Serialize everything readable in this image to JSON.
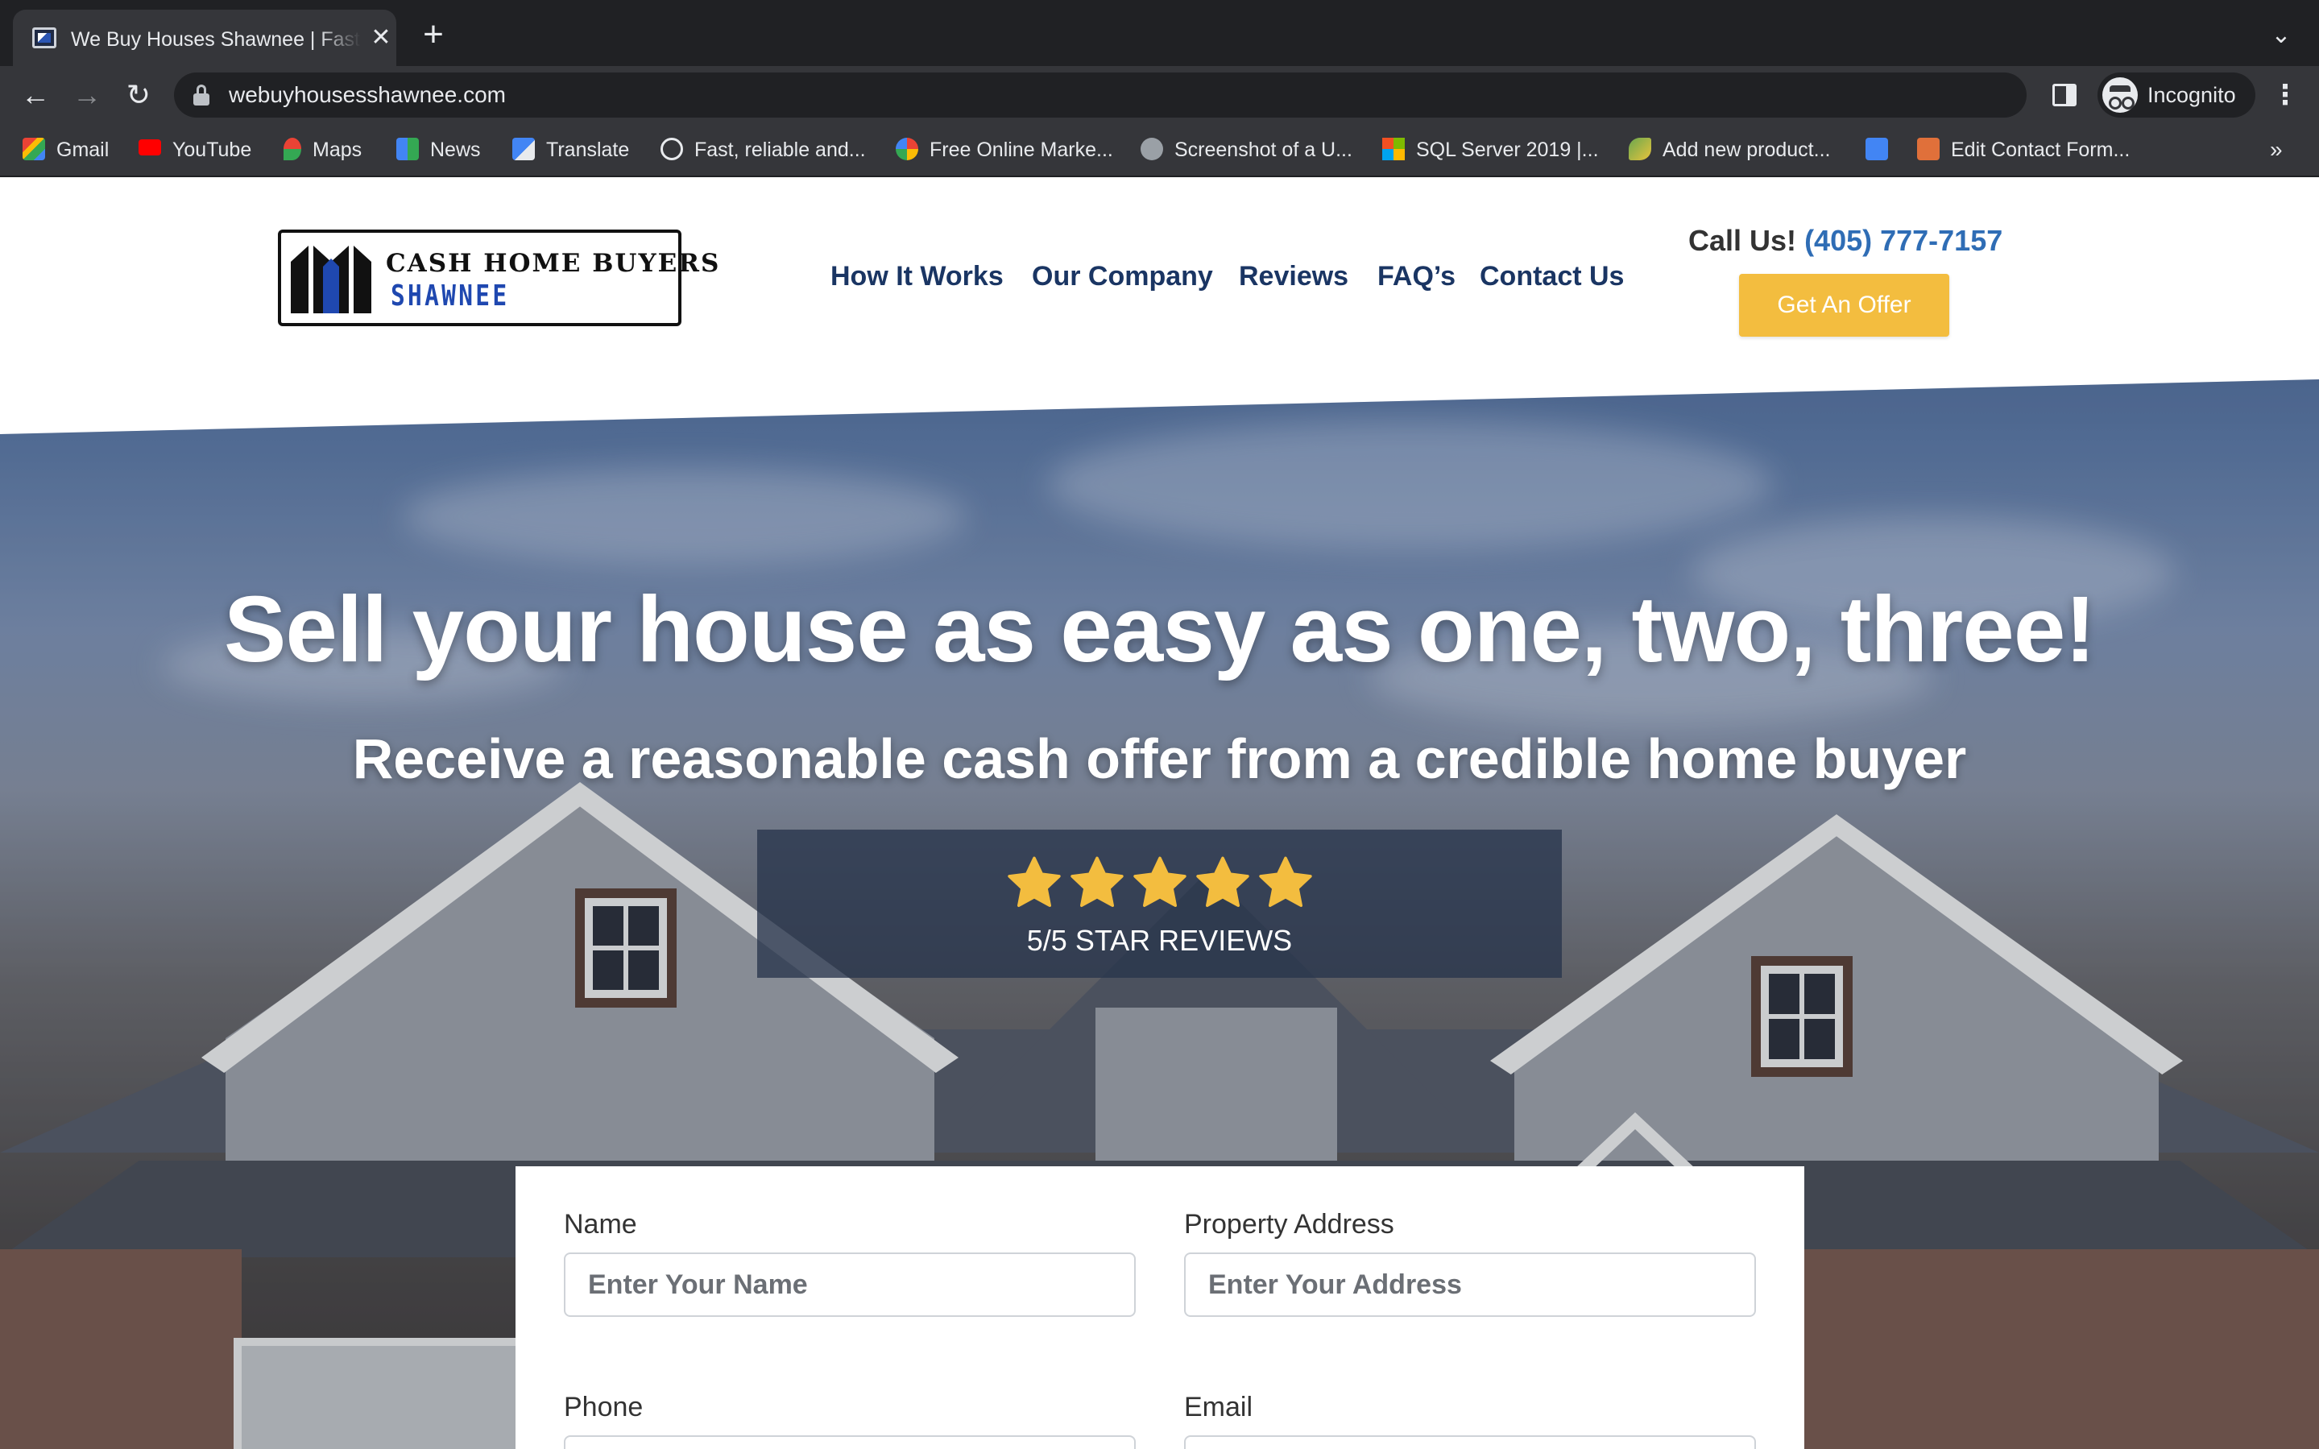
{
  "browser": {
    "tab_title": "We Buy Houses Shawnee | Fast Cash",
    "url": "webuyhousesshawnee.com",
    "profile_label": "Incognito",
    "bookmarks": [
      {
        "label": "Gmail",
        "icon": "gmail-icon",
        "color": "#ea4335"
      },
      {
        "label": "YouTube",
        "icon": "youtube-icon",
        "color": "#ff0000"
      },
      {
        "label": "Maps",
        "icon": "maps-icon",
        "color": "#34a853"
      },
      {
        "label": "News",
        "icon": "news-icon",
        "color": "#4285f4"
      },
      {
        "label": "Translate",
        "icon": "translate-icon",
        "color": "#4285f4"
      },
      {
        "label": "Fast, reliable and...",
        "icon": "site-icon",
        "color": "#e8eaed"
      },
      {
        "label": "Free Online Marke...",
        "icon": "google-icon",
        "color": "#4285f4"
      },
      {
        "label": "Screenshot of a U...",
        "icon": "globe-icon",
        "color": "#9aa0a6"
      },
      {
        "label": "SQL Server 2019 |...",
        "icon": "microsoft-icon",
        "color": "#f25022"
      },
      {
        "label": "Add new product...",
        "icon": "bird-icon",
        "color": "#6aa84f"
      },
      {
        "label": "Edit Contact Form...",
        "icon": "form-icon",
        "color": "#e0703a"
      }
    ]
  },
  "site": {
    "logo": {
      "line1": "CASH HOME BUYERS",
      "line2": "SHAWNEE"
    },
    "nav": [
      "How It Works",
      "Our Company",
      "Reviews",
      "FAQ’s",
      "Contact Us"
    ],
    "call_prefix": "Call Us!",
    "phone": "(405) 777-7157",
    "cta_button": "Get An Offer"
  },
  "hero": {
    "title": "Sell your house as easy as one, two, three!",
    "subtitle": "Receive a reasonable cash offer from a credible home buyer",
    "rating_stars": 5,
    "rating_label": "5/5 STAR REVIEWS",
    "star_color": "#f3bd3f"
  },
  "form": {
    "name_label": "Name",
    "name_placeholder": "Enter Your Name",
    "address_label": "Property Address",
    "address_placeholder": "Enter Your Address",
    "phone_label": "Phone",
    "email_label": "Email"
  }
}
